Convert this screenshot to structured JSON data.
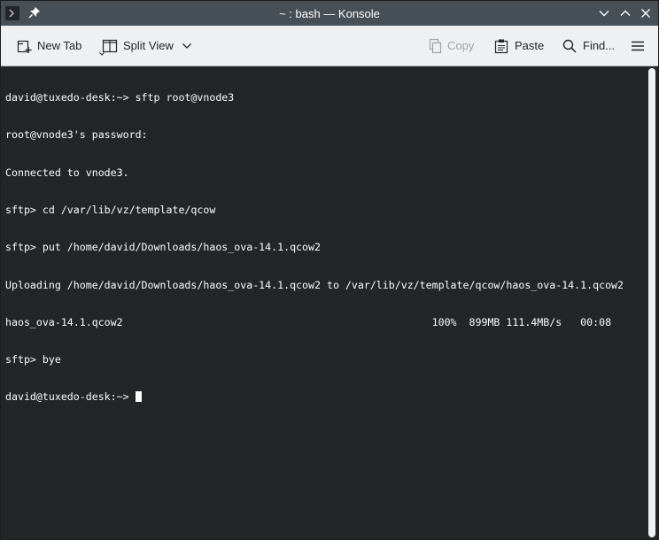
{
  "window": {
    "title": "~ : bash — Konsole",
    "icons": {
      "app": "konsole-icon",
      "pin": "pin-icon",
      "minimize": "chevron-down-icon",
      "maximize": "chevron-up-icon",
      "close": "close-icon"
    }
  },
  "toolbar": {
    "new_tab": "New Tab",
    "split_view": "Split View",
    "copy": "Copy",
    "paste": "Paste",
    "find": "Find...",
    "copy_enabled": false
  },
  "terminal": {
    "lines": [
      "david@tuxedo-desk:~> sftp root@vnode3",
      "root@vnode3's password:",
      "Connected to vnode3.",
      "sftp> cd /var/lib/vz/template/qcow",
      "sftp> put /home/david/Downloads/haos_ova-14.1.qcow2",
      "Uploading /home/david/Downloads/haos_ova-14.1.qcow2 to /var/lib/vz/template/qcow/haos_ova-14.1.qcow2",
      "haos_ova-14.1.qcow2                                                  100%  899MB 111.4MB/s   00:08",
      "sftp> bye"
    ],
    "prompt": "david@tuxedo-desk:~> "
  },
  "colors": {
    "titlebar": "#475057",
    "terminal_bg": "#232627",
    "terminal_fg": "#fcfcfc",
    "toolbar_bg": "#eff0f1"
  }
}
